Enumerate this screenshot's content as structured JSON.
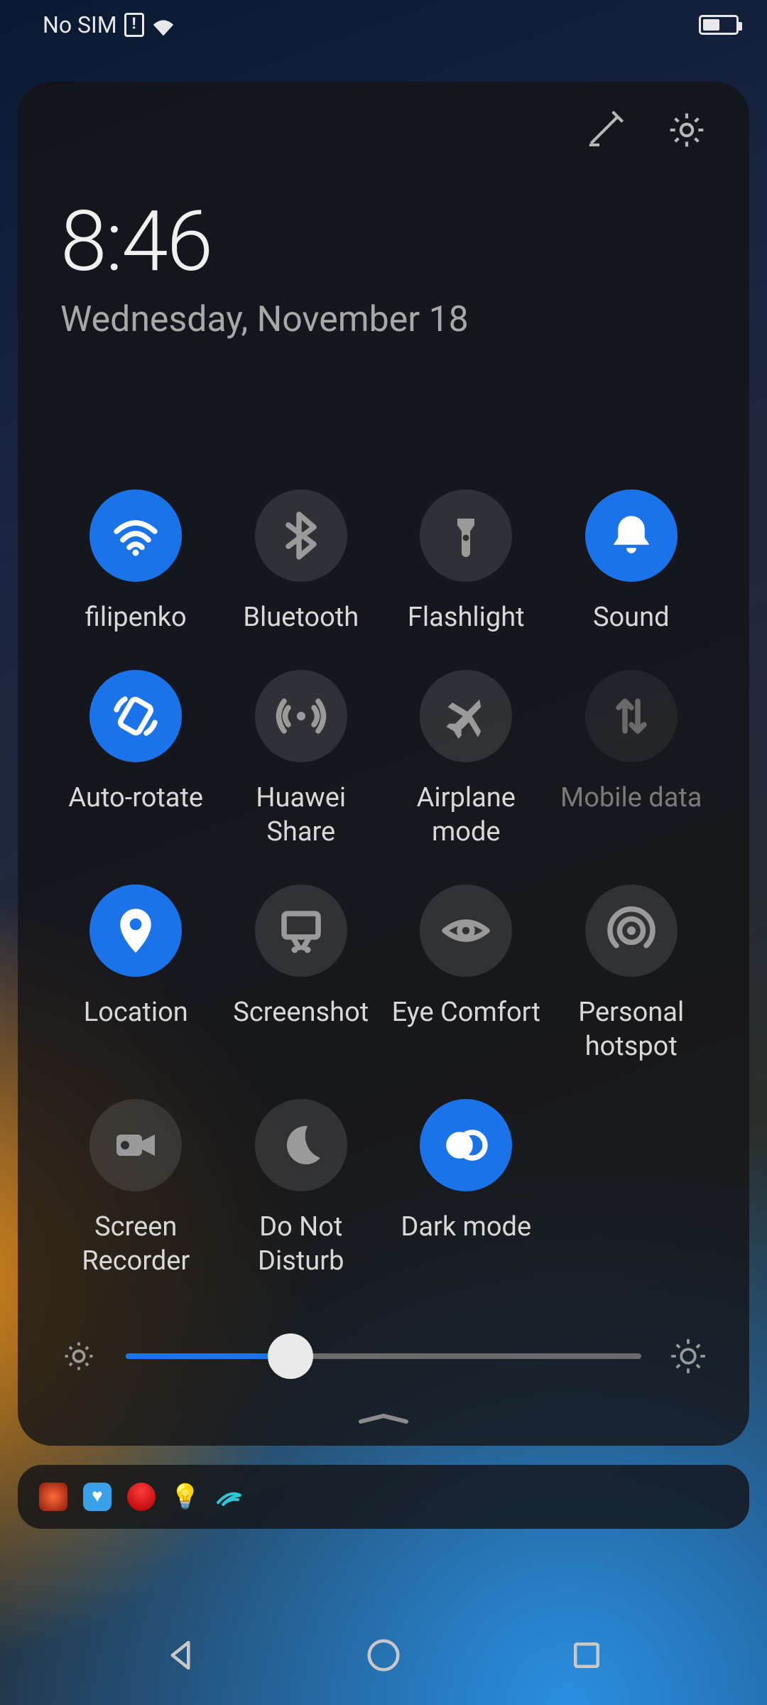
{
  "status": {
    "sim_text": "No SIM"
  },
  "panel": {
    "time": "8:46",
    "date": "Wednesday, November 18"
  },
  "toggles": [
    {
      "id": "wifi",
      "label": "filipenko",
      "icon": "wifi-icon",
      "on": true
    },
    {
      "id": "bluetooth",
      "label": "Bluetooth",
      "icon": "bluetooth-icon",
      "on": false
    },
    {
      "id": "flashlight",
      "label": "Flashlight",
      "icon": "flashlight-icon",
      "on": false
    },
    {
      "id": "sound",
      "label": "Sound",
      "icon": "bell-icon",
      "on": true
    },
    {
      "id": "auto-rotate",
      "label": "Auto-rotate",
      "icon": "rotate-icon",
      "on": true
    },
    {
      "id": "huawei-share",
      "label": "Huawei Share",
      "icon": "share-waves-icon",
      "on": false
    },
    {
      "id": "airplane",
      "label": "Airplane mode",
      "icon": "airplane-icon",
      "on": false
    },
    {
      "id": "mobile-data",
      "label": "Mobile data",
      "icon": "data-arrows-icon",
      "on": false,
      "disabled": true
    },
    {
      "id": "location",
      "label": "Location",
      "icon": "location-pin-icon",
      "on": true
    },
    {
      "id": "screenshot",
      "label": "Screenshot",
      "icon": "screenshot-icon",
      "on": false
    },
    {
      "id": "eye-comfort",
      "label": "Eye Comfort",
      "icon": "eye-icon",
      "on": false
    },
    {
      "id": "hotspot",
      "label": "Personal hotspot",
      "icon": "hotspot-icon",
      "on": false
    },
    {
      "id": "screen-recorder",
      "label": "Screen Recorder",
      "icon": "video-camera-icon",
      "on": false
    },
    {
      "id": "dnd",
      "label": "Do Not Disturb",
      "icon": "moon-icon",
      "on": false
    },
    {
      "id": "dark-mode",
      "label": "Dark mode",
      "icon": "dark-mode-icon",
      "on": true
    }
  ],
  "brightness": {
    "percent": 32
  },
  "notification_icons": [
    {
      "name": "game-icon",
      "color": "#d83a2a"
    },
    {
      "name": "health-icon",
      "color": "#3aa0e8"
    },
    {
      "name": "huawei-icon",
      "color": "#d83a2a"
    },
    {
      "name": "tips-icon",
      "color": "#c8c8c8"
    },
    {
      "name": "swoosh-icon",
      "color": "#2aa8b8"
    }
  ],
  "colors": {
    "accent": "#1a73e8"
  }
}
